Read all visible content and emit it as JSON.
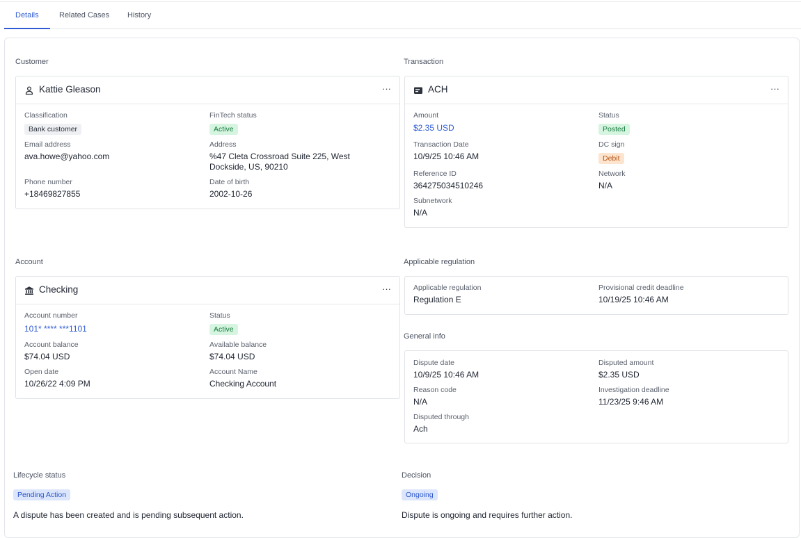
{
  "tabs": [
    {
      "label": "Details",
      "active": true
    },
    {
      "label": "Related Cases",
      "active": false
    },
    {
      "label": "History",
      "active": false
    }
  ],
  "customer": {
    "section_label": "Customer",
    "icon": "person-icon",
    "name": "Kattie Gleason",
    "classification_label": "Classification",
    "classification": "Bank customer",
    "fintech_status_label": "FinTech status",
    "fintech_status": "Active",
    "email_label": "Email address",
    "email": "ava.howe@yahoo.com",
    "address_label": "Address",
    "address": "%47 Cleta Crossroad Suite 225, West Dockside, US, 90210",
    "phone_label": "Phone number",
    "phone": "+18469827855",
    "dob_label": "Date of birth",
    "dob": "2002-10-26"
  },
  "transaction": {
    "section_label": "Transaction",
    "icon": "receipt-icon",
    "title": "ACH",
    "amount_label": "Amount",
    "amount": "$2.35 USD",
    "status_label": "Status",
    "status": "Posted",
    "date_label": "Transaction Date",
    "date": "10/9/25 10:46 AM",
    "dc_sign_label": "DC sign",
    "dc_sign": "Debit",
    "reference_label": "Reference ID",
    "reference": "364275034510246",
    "network_label": "Network",
    "network": "N/A",
    "subnetwork_label": "Subnetwork",
    "subnetwork": "N/A"
  },
  "account": {
    "section_label": "Account",
    "icon": "bank-icon",
    "title": "Checking",
    "number_label": "Account number",
    "number": "101* **** ***1101",
    "status_label": "Status",
    "status": "Active",
    "balance_label": "Account balance",
    "balance": "$74.04 USD",
    "available_label": "Available balance",
    "available": "$74.04 USD",
    "open_date_label": "Open date",
    "open_date": "10/26/22 4:09 PM",
    "name_label": "Account Name",
    "name": "Checking Account"
  },
  "regulation": {
    "section_label": "Applicable regulation",
    "regulation_label": "Applicable regulation",
    "regulation": "Regulation E",
    "deadline_label": "Provisional credit deadline",
    "deadline": "10/19/25 10:46 AM"
  },
  "general": {
    "section_label": "General info",
    "dispute_date_label": "Dispute date",
    "dispute_date": "10/9/25 10:46 AM",
    "disputed_amount_label": "Disputed amount",
    "disputed_amount": "$2.35 USD",
    "reason_label": "Reason code",
    "reason": "N/A",
    "investigation_label": "Investigation deadline",
    "investigation": "11/23/25 9:46 AM",
    "through_label": "Disputed through",
    "through": "Ach"
  },
  "lifecycle": {
    "section_label": "Lifecycle status",
    "badge": "Pending Action",
    "text": "A dispute has been created and is pending subsequent action."
  },
  "decision": {
    "section_label": "Decision",
    "badge": "Ongoing",
    "text": "Dispute is ongoing and requires further action."
  },
  "more_glyph": "···",
  "colors": {
    "accent": "#2f5bd3",
    "active_green": "#177a3d",
    "debit_orange": "#b5530f"
  }
}
